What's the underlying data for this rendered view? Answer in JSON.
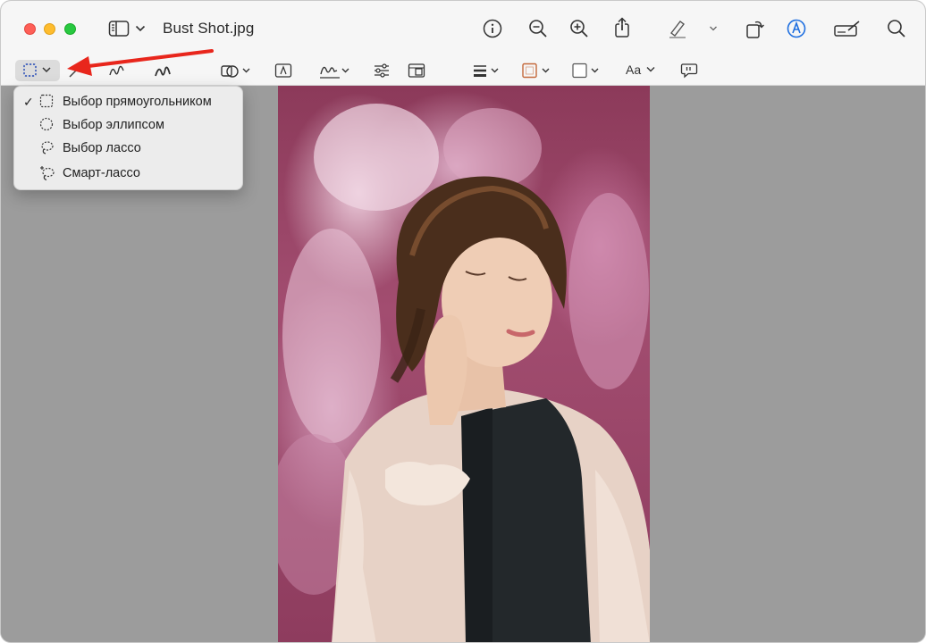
{
  "window": {
    "title": "Bust Shot.jpg"
  },
  "titlebar_icons": [
    "sidebar-icon",
    "chevron-down-icon",
    "info-icon",
    "zoom-out-icon",
    "zoom-in-icon",
    "share-icon",
    "highlight-pen-icon",
    "chevron-down-icon",
    "rotate-icon",
    "markup-icon",
    "sign-icon",
    "search-icon"
  ],
  "markup_toolbar": {
    "tools": [
      "rectangular-selection-icon",
      "instant-alpha-icon",
      "sketch-icon",
      "draw-icon",
      "shapes-icon",
      "text-box-icon",
      "signature-icon",
      "adjust-color-icon",
      "adjust-size-icon",
      "line-style-icon",
      "border-color-icon",
      "fill-color-icon",
      "text-style-icon",
      "note-icon"
    ],
    "text_style_label": "Aa"
  },
  "selection_menu": {
    "items": [
      {
        "label": "Выбор прямоугольником",
        "icon": "rectangle-selection-icon",
        "checked": true
      },
      {
        "label": "Выбор эллипсом",
        "icon": "ellipse-selection-icon",
        "checked": false
      },
      {
        "label": "Выбор лассо",
        "icon": "lasso-selection-icon",
        "checked": false
      },
      {
        "label": "Смарт-лассо",
        "icon": "smart-lasso-icon",
        "checked": false
      }
    ]
  },
  "annotation": {
    "arrow_color": "#e8261c"
  },
  "colors": {
    "titlebar": "#f6f6f6",
    "canvas": "#9c9c9c",
    "accent_blue": "#1f6fe0"
  }
}
